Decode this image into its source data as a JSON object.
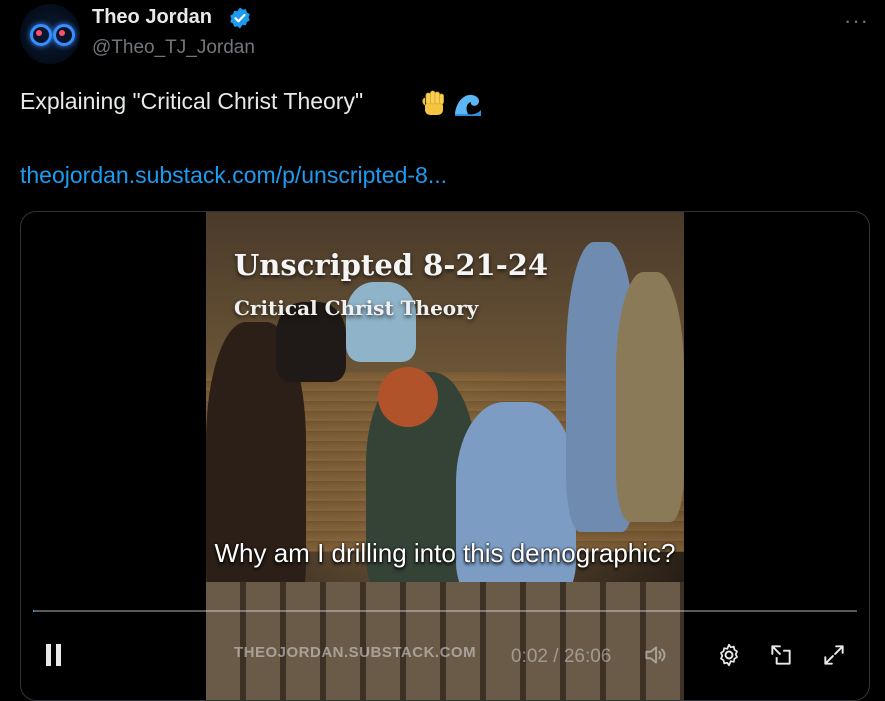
{
  "author": {
    "name": "Theo Jordan",
    "handle": "@Theo_TJ_Jordan"
  },
  "more_label": "···",
  "tweet": {
    "text": "Explaining \"Critical Christ Theory\"",
    "emojis": [
      "raised-fist",
      "water-wave"
    ],
    "link": "theojordan.substack.com/p/unscripted-8..."
  },
  "video": {
    "title": "Unscripted 8-21-24",
    "subtitle": "Critical Christ Theory",
    "caption": "Why am I drilling into this demographic?",
    "watermark": "THEOJORDAN.SUBSTACK.COM",
    "time": "0:02 / 26:06",
    "progress_fraction": 0.0013
  },
  "colors": {
    "link": "#1d9bf0",
    "verified": "#1d9bf0",
    "muted": "#71767b"
  }
}
